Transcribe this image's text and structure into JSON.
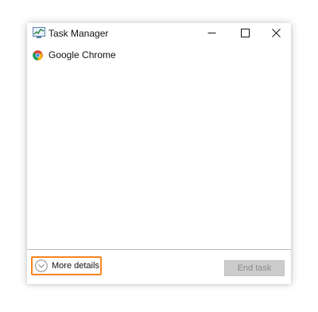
{
  "window": {
    "title": "Task Manager",
    "app_icon": "task-manager-icon",
    "controls": [
      "minimize-icon",
      "maximize-icon",
      "close-icon"
    ]
  },
  "processes": [
    {
      "name": "Google Chrome",
      "icon": "chrome-icon"
    }
  ],
  "footer": {
    "more_details_label": "More details",
    "more_details_icon": "chevron-down-circle-icon",
    "end_task_label": "End task",
    "end_task_enabled": false
  },
  "colors": {
    "highlight_border": "#f5861f",
    "disabled_button_bg": "#cccccc",
    "disabled_button_text": "#8a8a8a"
  }
}
